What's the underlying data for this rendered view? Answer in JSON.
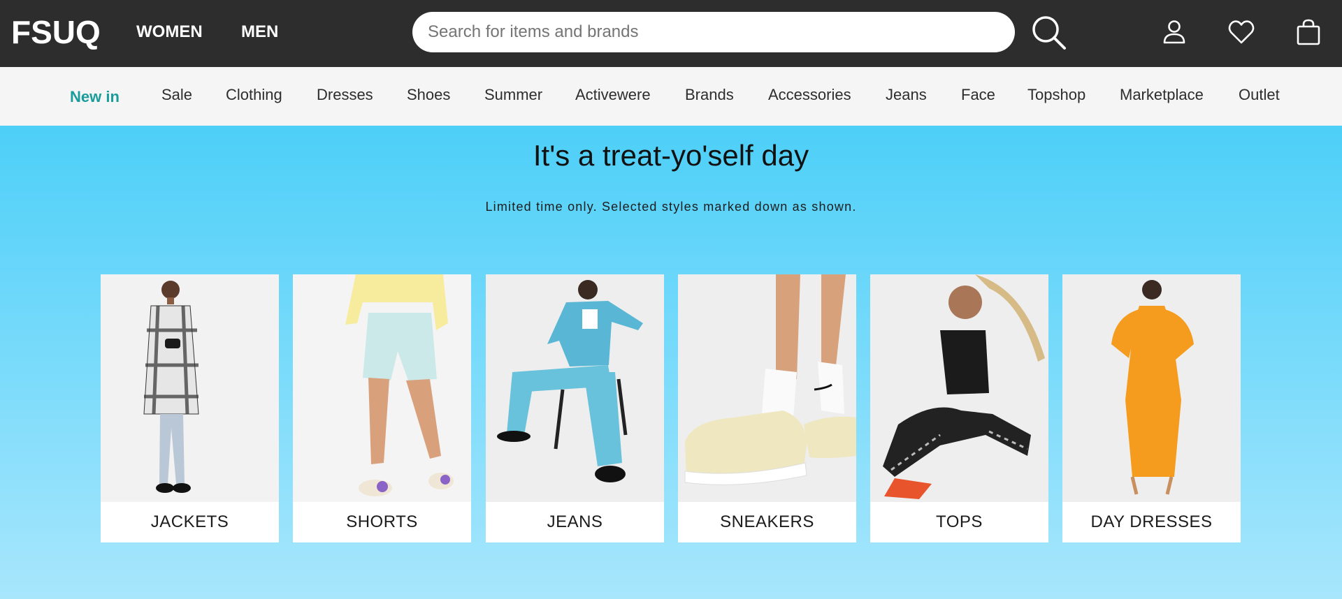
{
  "header": {
    "logo": "FSUQ",
    "gender_links": [
      "WOMEN",
      "MEN"
    ],
    "search_placeholder": "Search for items and brands",
    "icons": [
      "search-icon",
      "account-icon",
      "heart-icon",
      "shopping-bag-icon"
    ]
  },
  "category_nav": {
    "items": [
      "New in",
      "Sale",
      "Clothing",
      "Dresses",
      "Shoes",
      "Summer",
      "Activewere",
      "Brands",
      "Accessories",
      "Jeans",
      "Face",
      "Topshop",
      "Marketplace",
      "Outlet"
    ],
    "highlight_color": "#1a9c9c"
  },
  "hero": {
    "title": "It's a treat-yo'self day",
    "subtitle": "Limited time only. Selected styles marked down as shown.",
    "background_colors": [
      "#4dcff8",
      "#a8e6fc"
    ]
  },
  "tiles": [
    {
      "label": "JACKETS",
      "image": "woman-plaid-coat-photo"
    },
    {
      "label": "SHORTS",
      "image": "yellow-top-mint-shorts-photo"
    },
    {
      "label": "JEANS",
      "image": "blue-denim-set-photo"
    },
    {
      "label": "SNEAKERS",
      "image": "cream-sneakers-photo"
    },
    {
      "label": "TOPS",
      "image": "black-sports-top-photo"
    },
    {
      "label": "DAY DRESSES",
      "image": "orange-knit-dress-photo"
    }
  ]
}
